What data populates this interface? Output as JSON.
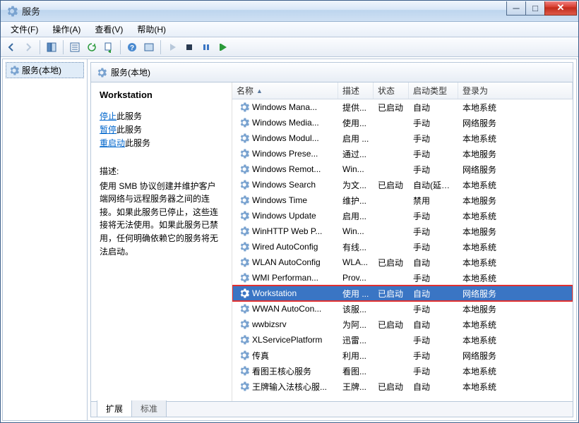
{
  "window": {
    "title": "服务"
  },
  "menu": {
    "file": "文件(F)",
    "action": "操作(A)",
    "view": "查看(V)",
    "help": "帮助(H)"
  },
  "tree": {
    "root": "服务(本地)"
  },
  "content_title": "服务(本地)",
  "detail": {
    "name": "Workstation",
    "stop": "停止",
    "stop_suffix": "此服务",
    "pause": "暂停",
    "pause_suffix": "此服务",
    "restart": "重启动",
    "restart_suffix": "此服务",
    "desc_label": "描述:",
    "desc_text": "使用 SMB 协议创建并维护客户端网络与远程服务器之间的连接。如果此服务已停止，这些连接将无法使用。如果此服务已禁用，任何明确依赖它的服务将无法启动。"
  },
  "columns": {
    "name": "名称",
    "desc": "描述",
    "status": "状态",
    "startup": "启动类型",
    "logon": "登录为"
  },
  "services": [
    {
      "name": "Windows Mana...",
      "desc": "提供...",
      "status": "已启动",
      "startup": "自动",
      "logon": "本地系统"
    },
    {
      "name": "Windows Media...",
      "desc": "使用...",
      "status": "",
      "startup": "手动",
      "logon": "网络服务"
    },
    {
      "name": "Windows Modul...",
      "desc": "启用 ...",
      "status": "",
      "startup": "手动",
      "logon": "本地系统"
    },
    {
      "name": "Windows Prese...",
      "desc": "通过...",
      "status": "",
      "startup": "手动",
      "logon": "本地服务"
    },
    {
      "name": "Windows Remot...",
      "desc": "Win...",
      "status": "",
      "startup": "手动",
      "logon": "网络服务"
    },
    {
      "name": "Windows Search",
      "desc": "为文...",
      "status": "已启动",
      "startup": "自动(延迟...",
      "logon": "本地系统"
    },
    {
      "name": "Windows Time",
      "desc": "维护...",
      "status": "",
      "startup": "禁用",
      "logon": "本地服务"
    },
    {
      "name": "Windows Update",
      "desc": "启用...",
      "status": "",
      "startup": "手动",
      "logon": "本地系统"
    },
    {
      "name": "WinHTTP Web P...",
      "desc": "Win...",
      "status": "",
      "startup": "手动",
      "logon": "本地服务"
    },
    {
      "name": "Wired AutoConfig",
      "desc": "有线...",
      "status": "",
      "startup": "手动",
      "logon": "本地系统"
    },
    {
      "name": "WLAN AutoConfig",
      "desc": "WLA...",
      "status": "已启动",
      "startup": "自动",
      "logon": "本地系统"
    },
    {
      "name": "WMI Performan...",
      "desc": "Prov...",
      "status": "",
      "startup": "手动",
      "logon": "本地系统"
    },
    {
      "name": "Workstation",
      "desc": "使用 ...",
      "status": "已启动",
      "startup": "自动",
      "logon": "网络服务",
      "selected": true
    },
    {
      "name": "WWAN AutoCon...",
      "desc": "该服...",
      "status": "",
      "startup": "手动",
      "logon": "本地服务"
    },
    {
      "name": "wwbizsrv",
      "desc": "为阿...",
      "status": "已启动",
      "startup": "自动",
      "logon": "本地系统"
    },
    {
      "name": "XLServicePlatform",
      "desc": "迅雷...",
      "status": "",
      "startup": "手动",
      "logon": "本地系统"
    },
    {
      "name": "传真",
      "desc": "利用...",
      "status": "",
      "startup": "手动",
      "logon": "网络服务"
    },
    {
      "name": "看图王核心服务",
      "desc": "看图...",
      "status": "",
      "startup": "手动",
      "logon": "本地系统"
    },
    {
      "name": "王牌输入法核心服...",
      "desc": "王牌...",
      "status": "已启动",
      "startup": "自动",
      "logon": "本地系统"
    }
  ],
  "tabs": {
    "extended": "扩展",
    "standard": "标准"
  }
}
